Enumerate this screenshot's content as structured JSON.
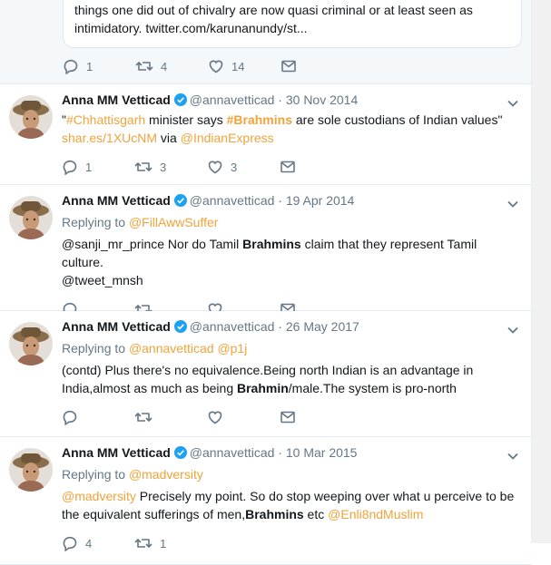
{
  "top_tweet": {
    "quote_line1": "things one did out of chivalry are now quasi criminal or at least seen as",
    "quote_line2": "intimidatory. twitter.com/karunanundy/st...",
    "replies": "1",
    "retweets": "4",
    "likes": "14"
  },
  "tweets": [
    {
      "name": "Anna MM Vetticad",
      "handle": "@annavetticad",
      "date": "30 Nov 2014",
      "line1_q": "\"",
      "line1_tag": "#Chhattisgarh",
      "line1_mid": " minister says ",
      "line1_tag2": "#Brahmins",
      "line1_end": " are sole custodians of Indian values\"",
      "link1": "shar.es/1XUcNM",
      "via": " via ",
      "link2": "@IndianExpress",
      "replies": "1",
      "retweets": "3",
      "likes": "3"
    },
    {
      "name": "Anna MM Vetticad",
      "handle": "@annavetticad",
      "date": "19 Apr 2014",
      "replying_label": "Replying to ",
      "replying_to": "@FillAwwSuffer",
      "text_a": "@sanji_mr_prince Nor do Tamil ",
      "text_bold": "Brahmins",
      "text_b": " claim that they represent Tamil culture.",
      "text_c": "@tweet_mnsh"
    },
    {
      "name": "Anna MM Vetticad",
      "handle": "@annavetticad",
      "date": "26 May 2017",
      "replying_label": "Replying to ",
      "replying_to": "@annavetticad",
      "replying_to2": "@p1j",
      "text_a": "(contd) Plus there's no equivalence.Being north Indian is an advantage in",
      "text_b": "India,almost as much as being ",
      "text_bold": "Brahmin",
      "text_c": "/male.The system is pro-north"
    },
    {
      "name": "Anna MM Vetticad",
      "handle": "@annavetticad",
      "date": "10 Mar 2015",
      "replying_label": "Replying to ",
      "replying_to": "@madversity",
      "mention": "@madversity",
      "text_a": " Precisely my point. So do stop weeping over what u perceive to be",
      "text_b": "the equivalent sufferings of men,",
      "text_bold": "Brahmins",
      "text_c": " etc ",
      "mention2": "@Enli8ndMuslim",
      "replies": "4",
      "retweets": "1"
    }
  ],
  "colors": {
    "link": "#f0a33a",
    "verified": "#1da1f2",
    "muted": "#657786"
  },
  "icons": [
    "reply-icon",
    "retweet-icon",
    "like-icon",
    "message-icon",
    "chevron-down-icon",
    "verified-badge-icon"
  ]
}
